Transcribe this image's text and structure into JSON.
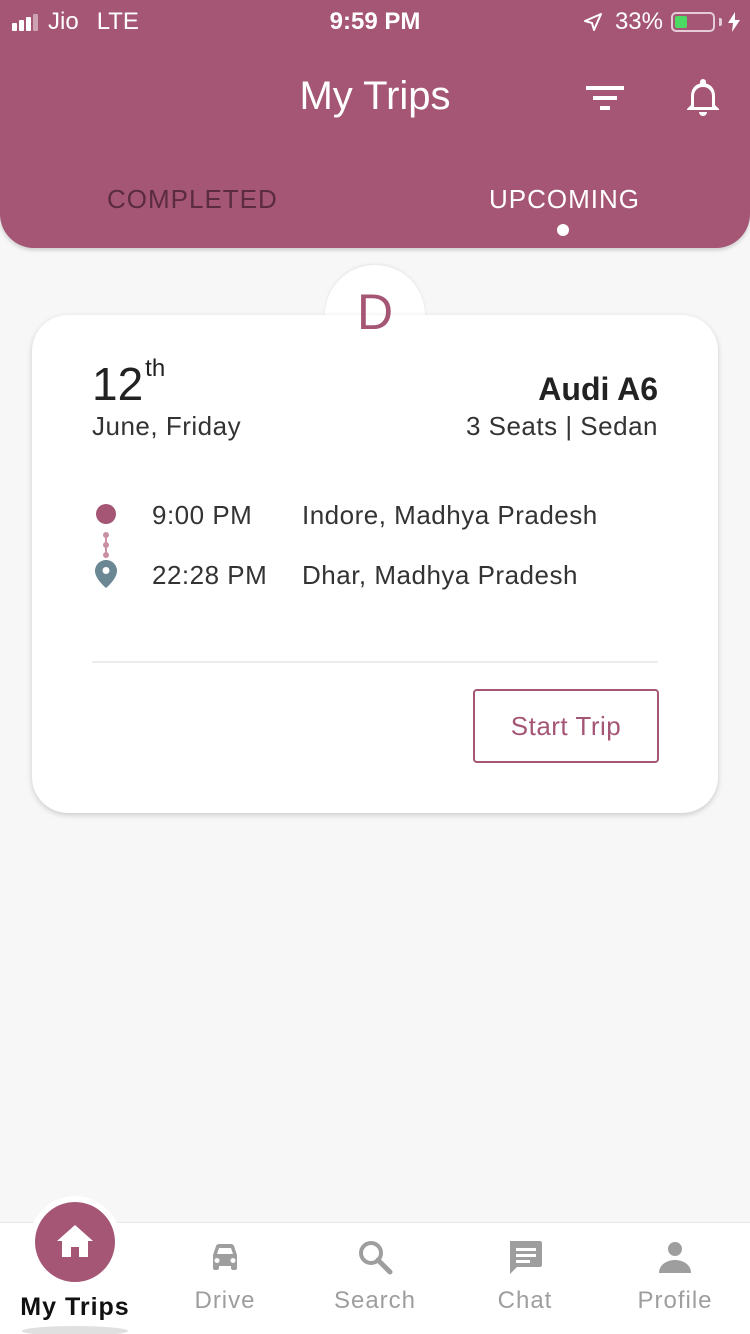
{
  "status_bar": {
    "carrier": "Jio",
    "network": "LTE",
    "time": "9:59 PM",
    "battery": "33%",
    "battery_level": 0.33
  },
  "header": {
    "title": "My Trips",
    "filter_icon": "filter-icon",
    "bell_icon": "bell-icon"
  },
  "tabs": [
    {
      "label": "COMPLETED",
      "active": false
    },
    {
      "label": "UPCOMING",
      "active": true
    }
  ],
  "trip": {
    "badge_letter": "D",
    "day": "12",
    "day_suffix": "th",
    "date_sub": "June, Friday",
    "car_name": "Audi A6",
    "car_sub": "3 Seats | Sedan",
    "start_time": "9:00 PM",
    "start_place": "Indore, Madhya Pradesh",
    "end_time": "22:28 PM",
    "end_place": "Dhar, Madhya Pradesh",
    "start_button": "Start Trip"
  },
  "colors": {
    "accent": "#a55675",
    "pin": "#6b8794",
    "battery_green": "#4cd964"
  },
  "bottom_nav": [
    {
      "label": "My Trips",
      "icon": "home-icon",
      "active": true
    },
    {
      "label": "Drive",
      "icon": "car-icon",
      "active": false
    },
    {
      "label": "Search",
      "icon": "search-icon",
      "active": false
    },
    {
      "label": "Chat",
      "icon": "chat-icon",
      "active": false
    },
    {
      "label": "Profile",
      "icon": "person-icon",
      "active": false
    }
  ]
}
